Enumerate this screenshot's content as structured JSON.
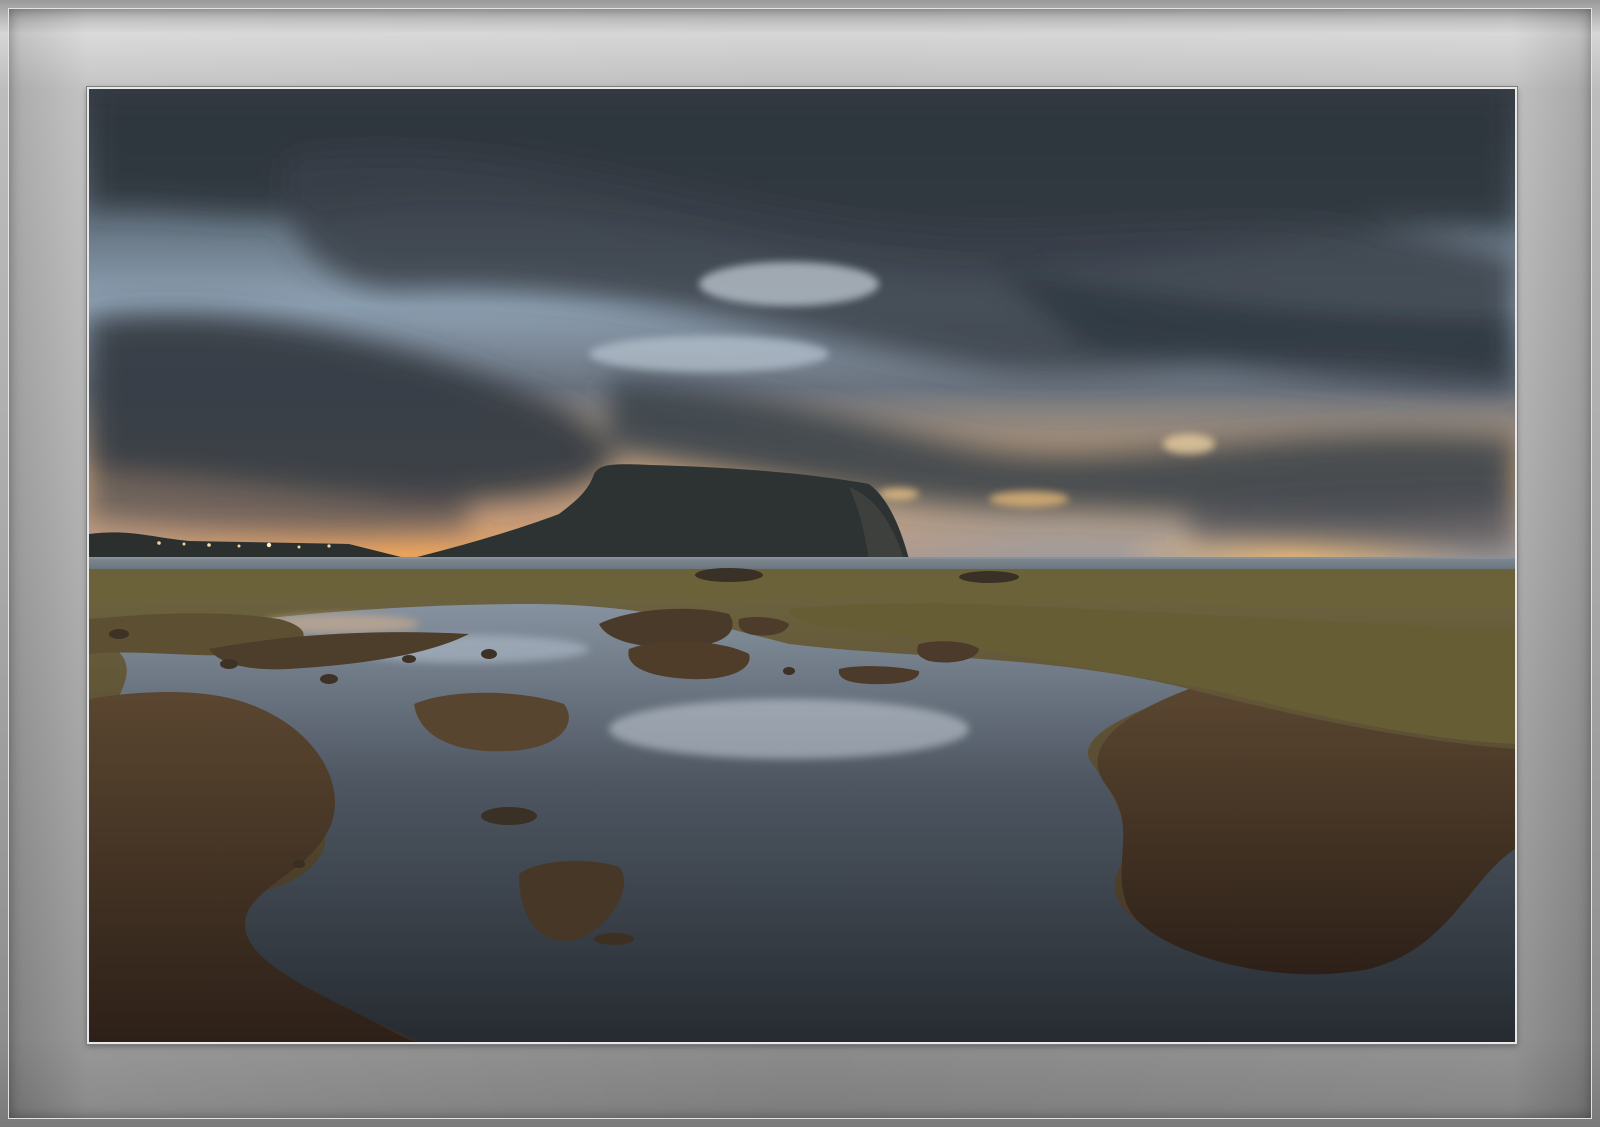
{
  "scene": {
    "subject": "seascape",
    "time_of_day": "dusk",
    "palette": {
      "sky_dark": "#2f353d",
      "sky_light": "#9fb2c4",
      "sunset": "#f0a45a",
      "headland": "#2c3130",
      "sea": "#5d6871",
      "rock": "#5a4733",
      "moss": "#6f6238",
      "pool": "#3d454d"
    }
  }
}
